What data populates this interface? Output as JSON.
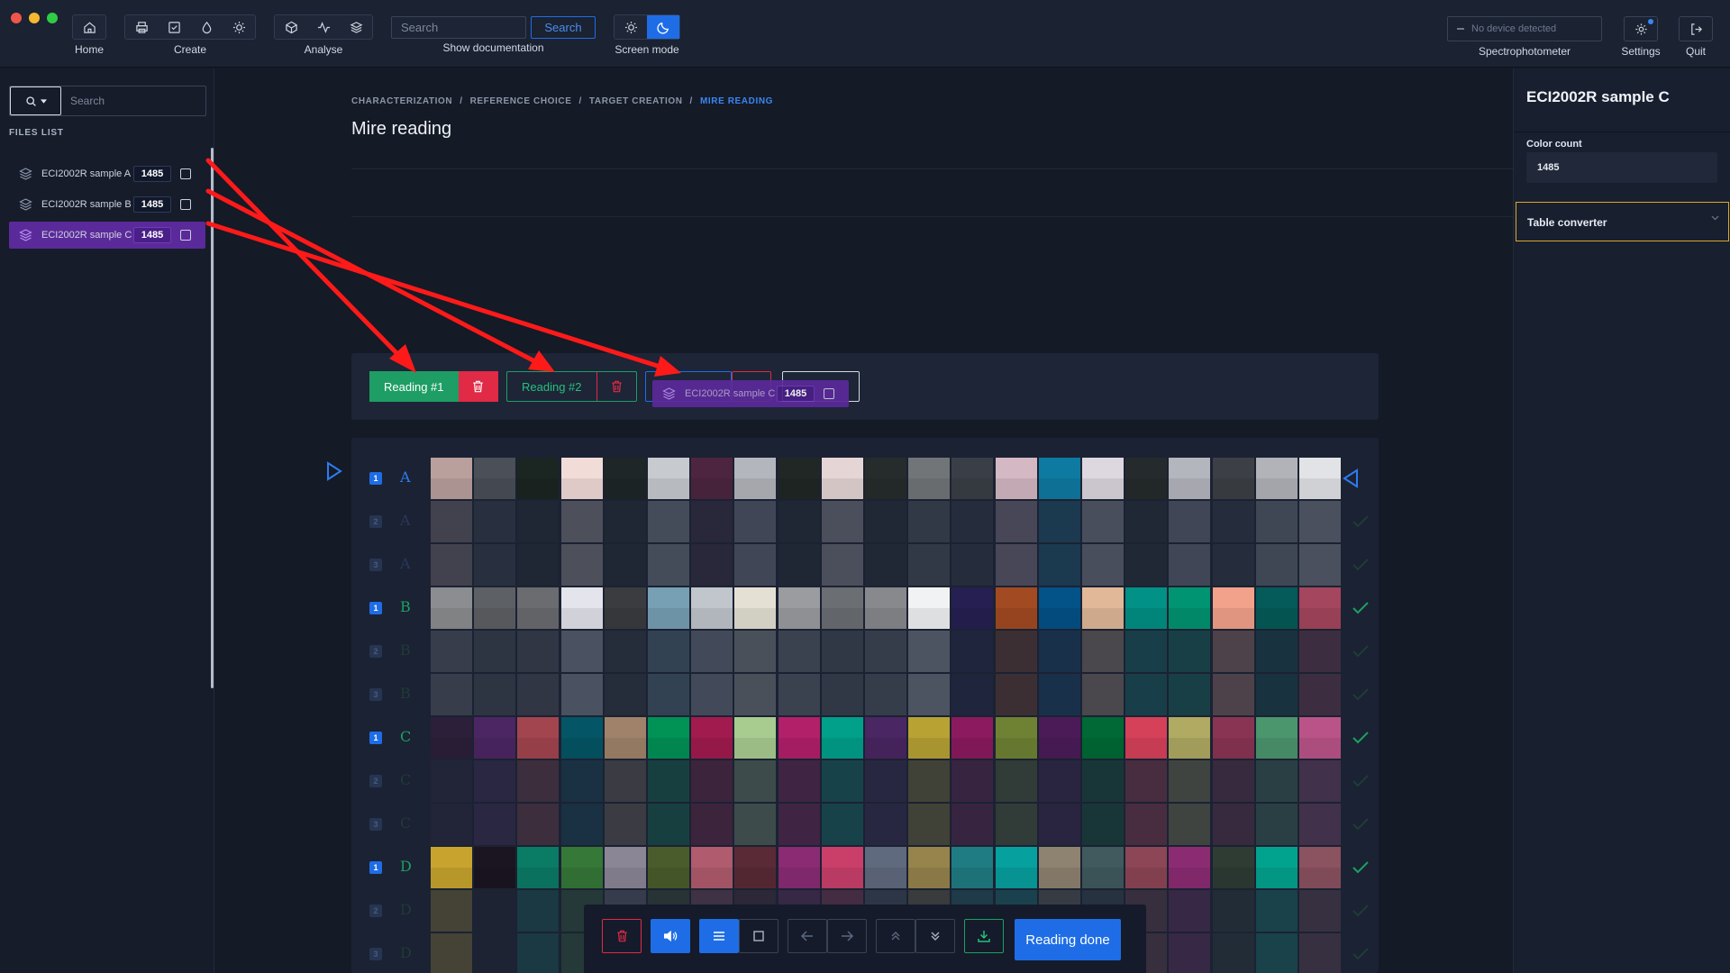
{
  "topbar": {
    "home_label": "Home",
    "create_label": "Create",
    "analyse_label": "Analyse",
    "search_placeholder": "Search",
    "search_button": "Search",
    "show_doc_label": "Show documentation",
    "screen_mode_label": "Screen mode",
    "device_status": "No device detected",
    "spectro_label": "Spectrophotometer",
    "settings_label": "Settings",
    "quit_label": "Quit"
  },
  "sidebar": {
    "search_placeholder": "Search",
    "files_title": "FILES LIST",
    "files": [
      {
        "name": "ECI2002R sample A",
        "count": "1485"
      },
      {
        "name": "ECI2002R sample B",
        "count": "1485"
      },
      {
        "name": "ECI2002R sample C",
        "count": "1485"
      }
    ]
  },
  "breadcrumb": [
    "CHARACTERIZATION",
    "REFERENCE CHOICE",
    "TARGET CREATION",
    "MIRE READING"
  ],
  "page_title": "Mire reading",
  "readings": [
    {
      "label": "Reading #1"
    },
    {
      "label": "Reading #2"
    }
  ],
  "drag_ghost": {
    "name": "ECI2002R sample C",
    "count": "1485"
  },
  "grid": {
    "rows": [
      {
        "letter": "A",
        "passes": [
          "1",
          "2",
          "3"
        ]
      },
      {
        "letter": "B",
        "passes": [
          "1",
          "2",
          "3"
        ]
      },
      {
        "letter": "C",
        "passes": [
          "1",
          "2",
          "3"
        ]
      },
      {
        "letter": "D",
        "passes": [
          "1",
          "2",
          "3"
        ]
      }
    ],
    "colors": {
      "A": [
        "#b9a09c",
        "#4a4f58",
        "#1b2521",
        "#f2dcd8",
        "#1e2627",
        "#c7cbd0",
        "#4d2540",
        "#b3b6bc",
        "#202725",
        "#e5d6d5",
        "#262c2c",
        "#727578",
        "#3a3e46",
        "#d4b8c3",
        "#0e7aa1",
        "#ddd7df",
        "#252b2c",
        "#b4b6be",
        "#3c3f45",
        "#b1b3b9",
        "#e2e3e6"
      ],
      "B": [
        "#8b8d90",
        "#5d6064",
        "#6b6c6f",
        "#e3e4ec",
        "#3b3c3f",
        "#77a0b4",
        "#c0c6cc",
        "#e4e1d4",
        "#9a9ca0",
        "#6b6e72",
        "#87898c",
        "#f1f2f3",
        "#251f52",
        "#a24a22",
        "#035288",
        "#e1b898",
        "#019186",
        "#019472",
        "#f2a28a",
        "#045b59",
        "#a4465e"
      ],
      "C": [
        "#2b1f39",
        "#4c2662",
        "#a3454f",
        "#045666",
        "#a0826a",
        "#019256",
        "#a11b4e",
        "#a8cc90",
        "#b2206a",
        "#00a08b",
        "#4a2663",
        "#b8a234",
        "#8b1a5f",
        "#6f8234",
        "#4b1b58",
        "#006935",
        "#d6415a",
        "#b0aa62",
        "#8a3453",
        "#4c966e",
        "#ba5488"
      ],
      "D": [
        "#c8a42e",
        "#1a1521",
        "#0a7b65",
        "#357838",
        "#8a8696",
        "#4a5c2c",
        "#b05b6e",
        "#5a2a36",
        "#8a2b74",
        "#c93f6a",
        "#606a7e",
        "#96844c",
        "#1f7c82",
        "#06a09e",
        "#8e8270",
        "#405a5e",
        "#8d4655",
        "#8b2c73",
        "#2e3c34",
        "#02a38e",
        "#8b5260"
      ]
    }
  },
  "bottom_bar": {
    "done_label": "Reading done"
  },
  "right_panel": {
    "title": "ECI2002R sample C",
    "color_count_label": "Color count",
    "color_count_value": "1485",
    "table_converter_label": "Table converter"
  },
  "colors": {
    "accent": "#1e6de6",
    "success": "#1e9e64",
    "danger": "#e02a46",
    "selected": "#5b2a9a"
  }
}
